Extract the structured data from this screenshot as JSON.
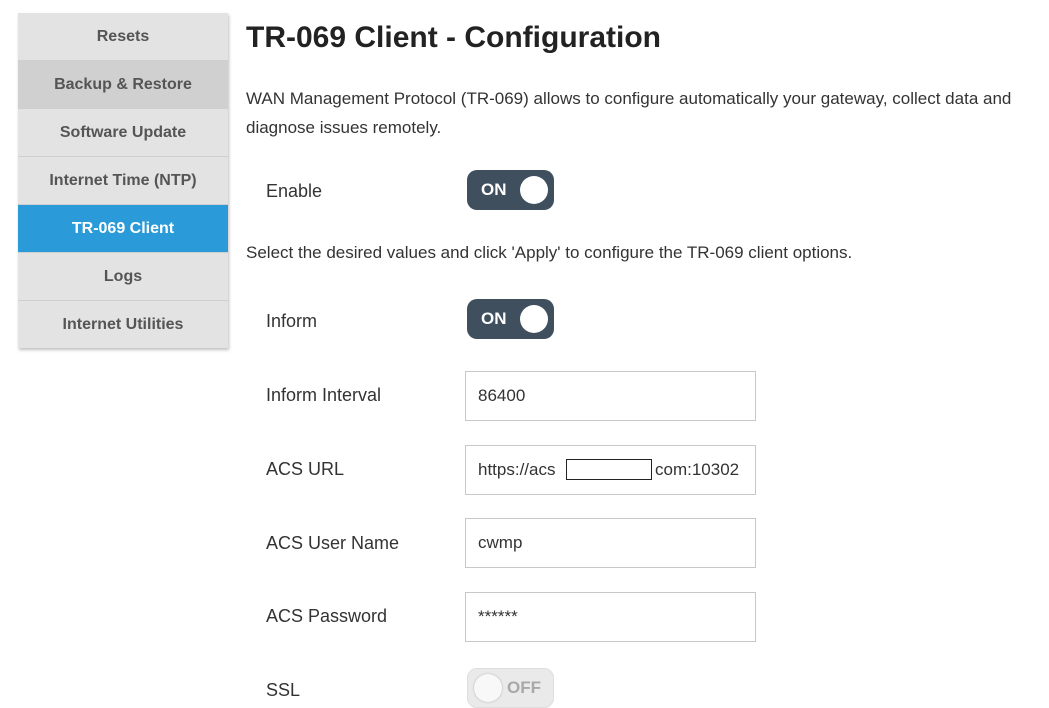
{
  "sidebar": {
    "items": [
      {
        "label": "Resets"
      },
      {
        "label": "Backup & Restore"
      },
      {
        "label": "Software Update"
      },
      {
        "label": "Internet Time (NTP)"
      },
      {
        "label": "TR-069 Client"
      },
      {
        "label": "Logs"
      },
      {
        "label": "Internet Utilities"
      }
    ],
    "active_item": "TR-069 Client",
    "active_color": "#2a9bd8"
  },
  "main": {
    "title": "TR-069 Client - Configuration",
    "description": "WAN Management Protocol (TR-069) allows to configure automatically your gateway, collect data and diagnose issues remotely.",
    "enable": {
      "label": "Enable",
      "state": "ON"
    },
    "instructions": "Select the desired values and click 'Apply' to configure the TR-069 client options.",
    "inform": {
      "label": "Inform",
      "state": "ON"
    },
    "inform_interval": {
      "label": "Inform Interval",
      "value": "86400"
    },
    "acs_url": {
      "label": "ACS URL",
      "value_prefix": "https://acs",
      "value_suffix": "com:10302"
    },
    "acs_user_name": {
      "label": "ACS User Name",
      "value": "cwmp"
    },
    "acs_password": {
      "label": "ACS Password",
      "value": "******"
    },
    "ssl": {
      "label": "SSL",
      "state": "OFF"
    }
  },
  "colors": {
    "toggle_on": "#3f4f5d",
    "toggle_off": "#eaeaea"
  }
}
